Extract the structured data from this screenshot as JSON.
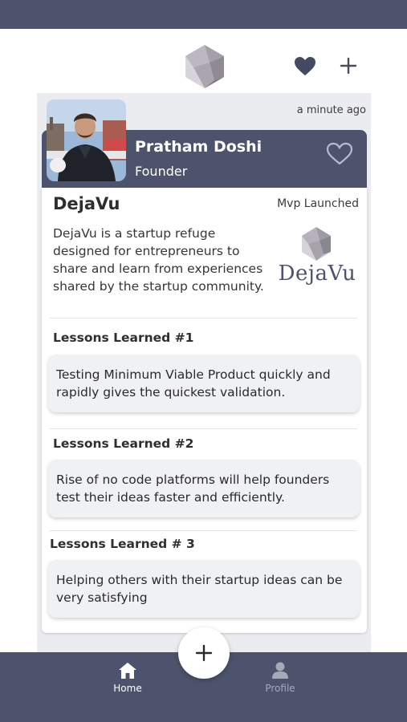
{
  "header": {
    "logo_icon": "dejavu-gem-icon",
    "favorites_icon": "heart-filled-icon",
    "add_icon": "plus-icon"
  },
  "post": {
    "timestamp": "a minute ago",
    "author": {
      "name": "Pratham Doshi",
      "role": "Founder",
      "like_icon": "heart-outline-icon"
    },
    "startup": {
      "name": "DejaVu",
      "stage": "Mvp Launched",
      "description": "DejaVu is a startup refuge designed for entrepreneurs to share and learn from experiences shared by the startup community.",
      "logo_text": "DejaVu"
    },
    "lessons": [
      {
        "title": "Lessons Learned #1",
        "text": "Testing Minimum Viable Product quickly and rapidly gives the quickest validation."
      },
      {
        "title": "Lessons Learned #2",
        "text": "Rise of no code platforms will help founders test their ideas faster and efficiently."
      },
      {
        "title": "Lessons Learned # 3",
        "text": "Helping others with their startup ideas can be very satisfying"
      }
    ]
  },
  "tabbar": {
    "tabs": [
      {
        "label": "Home",
        "icon": "home-icon",
        "active": true
      },
      {
        "label": "Profile",
        "icon": "person-icon",
        "active": false
      }
    ],
    "fab_icon": "plus-icon"
  },
  "colors": {
    "primary": "#4e536d",
    "background": "#ebecef",
    "card": "#ffffff",
    "lesson_box": "#f0f1f3"
  }
}
